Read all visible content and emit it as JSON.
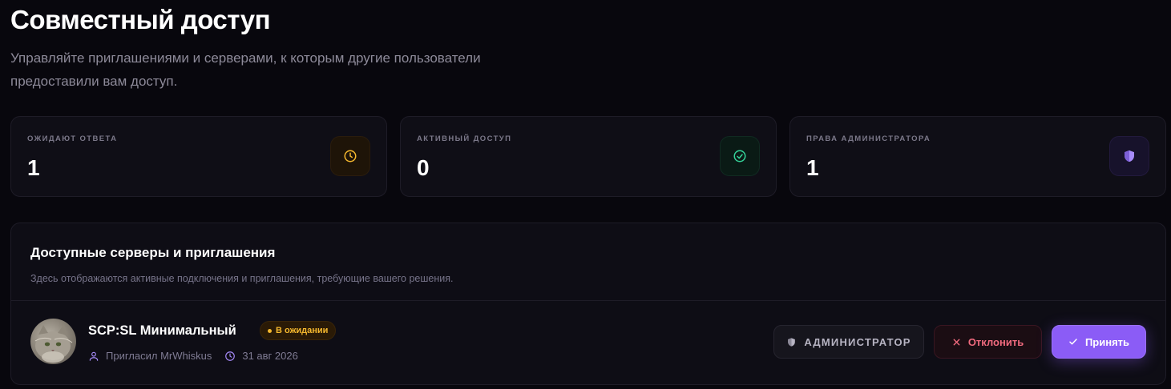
{
  "header": {
    "title": "Совместный доступ",
    "subtitle": "Управляйте приглашениями и серверами, к которым другие пользователи предоставили вам доступ."
  },
  "stats": [
    {
      "label": "Ожидают ответа",
      "value": "1",
      "icon": "clock-icon",
      "color": "#f5b82e"
    },
    {
      "label": "Активный доступ",
      "value": "0",
      "icon": "check-circle-icon",
      "color": "#34d399"
    },
    {
      "label": "Права администратора",
      "value": "1",
      "icon": "shield-icon",
      "color": "#a78bfa"
    }
  ],
  "panel": {
    "title": "Доступные серверы и приглашения",
    "subtitle": "Здесь отображаются активные подключения и приглашения, требующие вашего решения."
  },
  "invite": {
    "server_name": "SCP:SL Минимальный",
    "status": "В ожидании",
    "invited_by": "Пригласил MrWhiskus",
    "date": "31 авг 2026",
    "role_label": "АДМИНИСТРАТОР",
    "reject_label": "Отклонить",
    "accept_label": "Принять"
  },
  "colors": {
    "accent": "#8b5cf6",
    "pending": "#f5b82e",
    "danger": "#f06a7e",
    "background": "#08070d"
  }
}
